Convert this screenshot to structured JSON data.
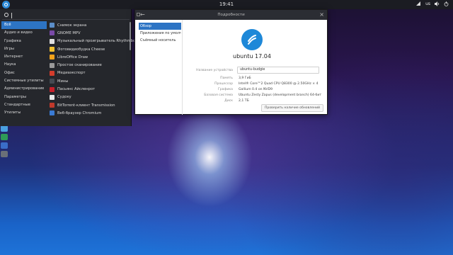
{
  "topbar": {
    "clock": "19:41",
    "lang": "us"
  },
  "menu": {
    "categories": [
      {
        "label": "Всё",
        "active": true
      },
      {
        "label": "Аудио и видео"
      },
      {
        "label": "Графика"
      },
      {
        "label": "Игры"
      },
      {
        "label": "Интернет"
      },
      {
        "label": "Наука"
      },
      {
        "label": "Офис"
      },
      {
        "label": "Системные утилиты"
      },
      {
        "label": "Администрирование"
      },
      {
        "label": "Параметры"
      },
      {
        "label": "Стандартные"
      },
      {
        "label": "Утилиты"
      }
    ],
    "apps": [
      {
        "label": "Снимок экрана",
        "icon": "screenshot-icon",
        "color": "#5b8ec9"
      },
      {
        "label": "GNOME MPV",
        "icon": "mpv-icon",
        "color": "#7a4aa8"
      },
      {
        "label": "Музыкальный проигрыватель Rhythmbox",
        "icon": "rhythmbox-icon",
        "color": "#e0e0e0"
      },
      {
        "label": "Фотовидеобудка Cheese",
        "icon": "cheese-icon",
        "color": "#f0c030"
      },
      {
        "label": "LibreOffice Draw",
        "icon": "draw-icon",
        "color": "#f2a21a"
      },
      {
        "label": "Простое сканирование",
        "icon": "scanner-icon",
        "color": "#9a9a9a"
      },
      {
        "label": "Медиаэкспорт",
        "icon": "media-icon",
        "color": "#d33c2c"
      },
      {
        "label": "Мины",
        "icon": "mines-icon",
        "color": "#444a52"
      },
      {
        "label": "Пасьянс Айсленрот",
        "icon": "solitaire-icon",
        "color": "#c8202a"
      },
      {
        "label": "Судоку",
        "icon": "sudoku-icon",
        "color": "#e8e8e8"
      },
      {
        "label": "BitTorrent-клиент Transmission",
        "icon": "transmission-icon",
        "color": "#c0392b"
      },
      {
        "label": "Веб-браузер Chromium",
        "icon": "chromium-icon",
        "color": "#3a7bd5"
      }
    ]
  },
  "window": {
    "title": "Подробности",
    "sidebar": [
      {
        "label": "Обзор",
        "active": true
      },
      {
        "label": "Приложения по умолчанию"
      },
      {
        "label": "Съёмный носитель"
      }
    ],
    "os_name": "ubuntu 17.04",
    "device_name_label": "Название устройства",
    "device_name_value": "ubuntu-budgie",
    "details": [
      {
        "label": "Память",
        "value": "3,9 ГиБ"
      },
      {
        "label": "Процессор",
        "value": "Intel® Core™2 Quad CPU Q8300 @ 2.50GHz × 4"
      },
      {
        "label": "Графика",
        "value": "Gallium 0.4 on NVD9"
      },
      {
        "label": "Базовая система",
        "value": "Ubuntu Zesty Zapus (development branch) 64-бит"
      },
      {
        "label": "Диск",
        "value": "2,1 ТБ"
      }
    ],
    "check_updates": "Проверить наличие обновлений"
  },
  "dock_colors": [
    "#2f4a7a",
    "#4aa0e0",
    "#2e9a58",
    "#3a6ec8",
    "#6a6f78"
  ],
  "accent": "#2d74c4"
}
